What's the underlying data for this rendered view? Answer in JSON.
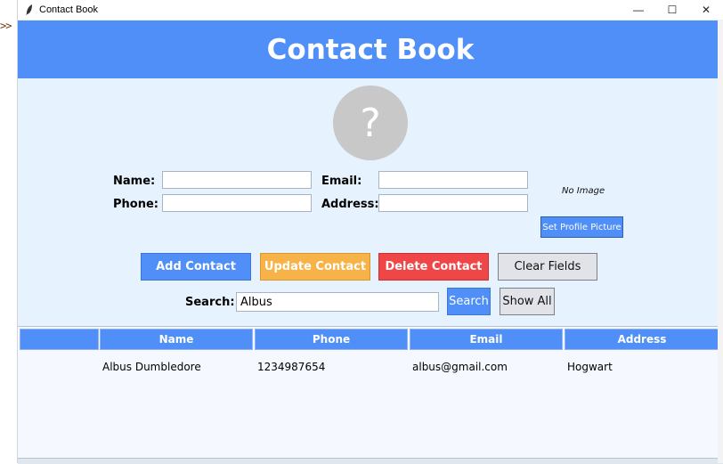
{
  "gutter": {
    "glyph": ">>"
  },
  "window": {
    "title": "Contact Book",
    "controls": {
      "minimize": "—",
      "maximize": "☐",
      "close": "✕"
    }
  },
  "header": {
    "title": "Contact Book"
  },
  "avatar": {
    "placeholder": "?"
  },
  "form": {
    "name_label": "Name:",
    "phone_label": "Phone:",
    "email_label": "Email:",
    "address_label": "Address:",
    "name_value": "",
    "phone_value": "",
    "email_value": "",
    "address_value": ""
  },
  "profile": {
    "no_image_text": "No Image",
    "set_picture_label": "Set Profile Picture"
  },
  "actions": {
    "add_label": "Add Contact",
    "update_label": "Update Contact",
    "delete_label": "Delete Contact",
    "clear_label": "Clear Fields"
  },
  "search": {
    "label": "Search:",
    "value": "Albus",
    "search_button": "Search",
    "show_all_button": "Show All"
  },
  "table": {
    "columns": [
      "",
      "Name",
      "Phone",
      "Email",
      "Address"
    ],
    "rows": [
      {
        "name": "Albus Dumbledore",
        "phone": "1234987654",
        "email": "albus@gmail.com",
        "address": "Hogwart"
      }
    ]
  },
  "colors": {
    "accent": "#4f8ff7",
    "background": "#e7f2ff",
    "update": "#f7b347",
    "delete": "#ef4747",
    "neutral_button": "#e1e3e8"
  },
  "icons": {
    "app": "feather-icon",
    "avatar": "question-mark-icon"
  }
}
